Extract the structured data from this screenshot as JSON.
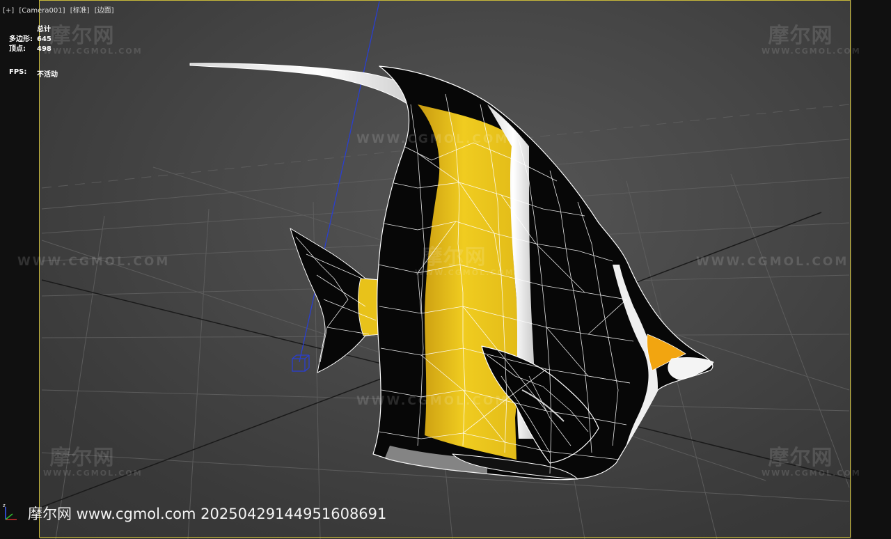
{
  "viewport": {
    "labels": [
      "[+]",
      "[Camera001]",
      "[标准]",
      "[边面]"
    ]
  },
  "stats": {
    "header": "总计",
    "polygons_label": "多边形:",
    "polygons_value": "645",
    "vertices_label": "顶点:",
    "vertices_value": "498",
    "fps_label": "FPS:",
    "fps_value": "不活动"
  },
  "watermarks": {
    "logo_big": "摩尔网",
    "logo_small": "WWW.CGMOL.COM",
    "url": "WWW.CGMOL.COM"
  },
  "footer": {
    "text": "摩尔网 www.cgmol.com 20250429144951608691"
  },
  "colors": {
    "frame": "#c8b93a",
    "fish_black": "#070707",
    "fish_yellow": "#e8c21a",
    "fish_white": "#f0f0f0",
    "fish_orange": "#f2a510",
    "camera_line": "#2a3fd0",
    "wireframe": "#ffffff"
  }
}
